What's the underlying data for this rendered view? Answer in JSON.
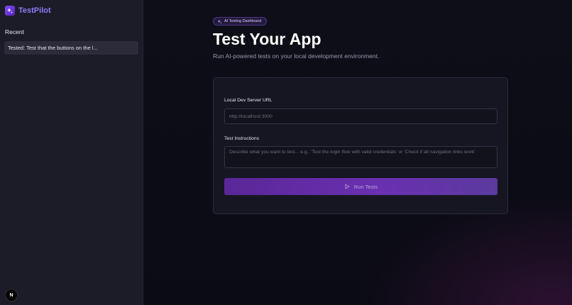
{
  "sidebar": {
    "brand": "TestPilot",
    "recent_label": "Recent",
    "recent_items": [
      "Tested: Test that the buttons on the l..."
    ],
    "badge": "N"
  },
  "main": {
    "pill": "AI Testing Dashboard",
    "title": "Test Your App",
    "subtitle": "Run AI-powered tests on your local development environment.",
    "url_label": "Local Dev Server URL",
    "url_placeholder": "http://localhost:3000",
    "instructions_label": "Test Instructions",
    "instructions_placeholder": "Describe what you want to test... e.g., 'Test the login flow with valid credentials' or 'Check if all navigation links work'",
    "run_button": "Run Tests"
  },
  "colors": {
    "accent": "#8b7cf6",
    "button": "#6a2fb0"
  }
}
